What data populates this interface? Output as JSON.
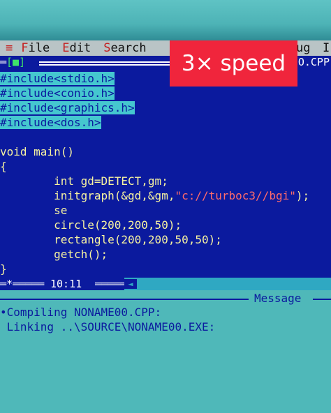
{
  "menu": {
    "system": "≡",
    "items": [
      {
        "hot": "F",
        "rest": "ile"
      },
      {
        "hot": "E",
        "rest": "dit"
      },
      {
        "hot": "S",
        "rest": "earch"
      }
    ],
    "partial_right": "ug",
    "partial_last": "I"
  },
  "editor": {
    "close_box": "[■]",
    "filename": "O.CPP",
    "code": [
      {
        "type": "include",
        "text": "#include<stdio.h>"
      },
      {
        "type": "include",
        "text": "#include<conio.h>"
      },
      {
        "type": "include",
        "text": "#include<graphics.h>"
      },
      {
        "type": "include",
        "text": "#include<dos.h>"
      },
      {
        "type": "plain",
        "text": ""
      },
      {
        "type": "plain",
        "text": "void main()"
      },
      {
        "type": "plain",
        "text": "{"
      },
      {
        "type": "plain",
        "text": "        int gd=DETECT,gm;"
      },
      {
        "type": "initgraph",
        "prefix": "        initgraph(&gd,&gm,",
        "str": "\"c://turboc3//bgi\"",
        "suffix": ");"
      },
      {
        "type": "plain",
        "text": "        se"
      },
      {
        "type": "plain",
        "text": "        circle(200,200,50);"
      },
      {
        "type": "plain",
        "text": "        rectangle(200,200,50,50);"
      },
      {
        "type": "plain",
        "text": "        getch();"
      },
      {
        "type": "plain",
        "text": "}"
      }
    ]
  },
  "status": {
    "left_marker": "*",
    "cursor_position": "10:11"
  },
  "message_window": {
    "title": "Message",
    "lines": [
      "•Compiling NONAME00.CPP:",
      " Linking ..\\SOURCE\\NONAME00.EXE:"
    ]
  },
  "overlay_badge": "3× speed",
  "colors": {
    "editor_bg": "#0b1a9e",
    "code_text": "#f7f3a0",
    "include_highlight": "#45c7cf",
    "string_literal": "#ff6b6b",
    "menu_bg": "#b9c4c6",
    "message_bg": "#4fb8b9",
    "badge_bg": "#f0253c"
  }
}
